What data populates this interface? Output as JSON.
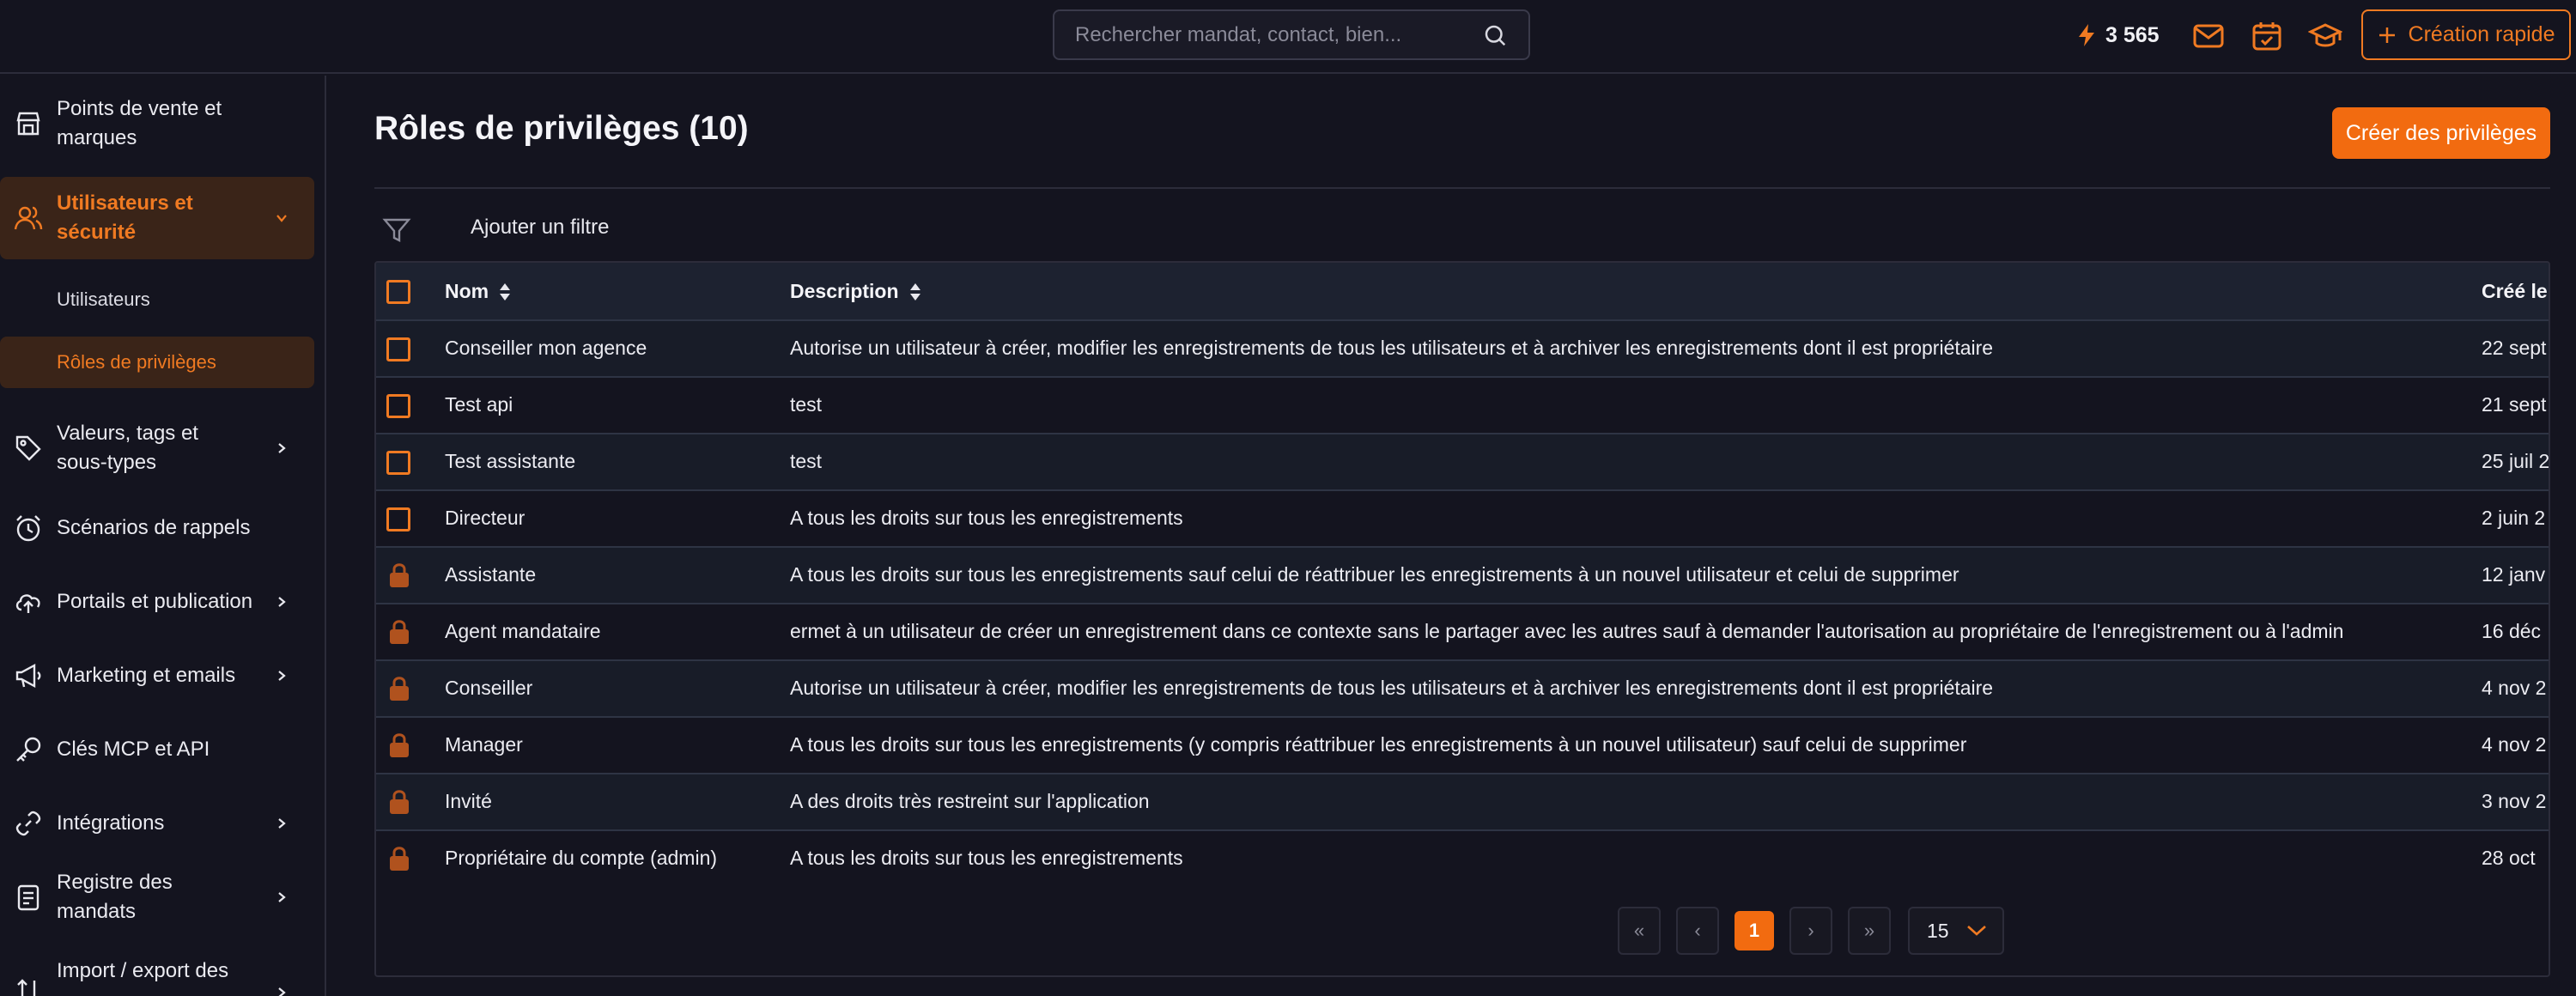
{
  "header": {
    "search_placeholder": "Rechercher mandat, contact, bien...",
    "credits": "3 565",
    "quick_create_label": "Création rapide"
  },
  "icons": {
    "search": "search-icon",
    "bolt": "bolt-icon",
    "mail": "mail-icon",
    "calendar": "calendar-check-icon",
    "academy": "graduation-cap-icon",
    "plus": "plus-icon",
    "filter": "filter-icon",
    "lock": "lock-icon",
    "sort": "sort-icon"
  },
  "colors": {
    "accent": "#f07a22",
    "accent_bg": "#3a2418",
    "background": "#14141f",
    "lock": "#b0521e"
  },
  "sidebar": {
    "items": [
      {
        "label": "Points de vente et marques"
      },
      {
        "label": "Utilisateurs et sécurité"
      },
      {
        "label": "Valeurs, tags et sous-types"
      },
      {
        "label": "Scénarios de rappels"
      },
      {
        "label": "Portails et publication"
      },
      {
        "label": "Marketing et emails"
      },
      {
        "label": "Clés MCP et API"
      },
      {
        "label": "Intégrations"
      },
      {
        "label": "Registre des mandats"
      },
      {
        "label": "Import / export des"
      }
    ],
    "sub_items": [
      {
        "label": "Utilisateurs"
      },
      {
        "label": "Rôles de privilèges"
      }
    ]
  },
  "main": {
    "title": "Rôles de privilèges (10)",
    "create_button": "Créer des privilèges",
    "add_filter": "Ajouter un filtre",
    "columns": {
      "name": "Nom",
      "description": "Description",
      "created": "Créé le"
    },
    "rows": [
      {
        "name": "Conseiller mon agence",
        "description": "Autorise un utilisateur à créer, modifier les enregistrements de tous les utilisateurs et à archiver les enregistrements dont il est propriétaire",
        "date": "22 sept",
        "locked": false
      },
      {
        "name": "Test api",
        "description": "test",
        "date": "21 sept",
        "locked": false
      },
      {
        "name": "Test assistante",
        "description": "test",
        "date": "25 juil 2",
        "locked": false
      },
      {
        "name": "Directeur",
        "description": "A tous les droits sur tous les enregistrements",
        "date": "2 juin 2",
        "locked": false
      },
      {
        "name": "Assistante",
        "description": "A tous les droits sur tous les enregistrements sauf celui de réattribuer les enregistrements à un nouvel utilisateur et celui de supprimer",
        "date": "12 janv",
        "locked": true
      },
      {
        "name": "Agent mandataire",
        "description": "ermet à un utilisateur de créer un enregistrement dans ce contexte sans le partager avec les autres sauf à demander l'autorisation au propriétaire de l'enregistrement ou à l'admin",
        "date": "16 déc",
        "locked": true
      },
      {
        "name": "Conseiller",
        "description": "Autorise un utilisateur à créer, modifier les enregistrements de tous les utilisateurs et à archiver les enregistrements dont il est propriétaire",
        "date": "4 nov 2",
        "locked": true
      },
      {
        "name": "Manager",
        "description": "A tous les droits sur tous les enregistrements (y compris réattribuer les enregistrements à un nouvel utilisateur) sauf celui de supprimer",
        "date": "4 nov 2",
        "locked": true
      },
      {
        "name": "Invité",
        "description": "A des droits très restreint sur l'application",
        "date": "3 nov 2",
        "locked": true
      },
      {
        "name": "Propriétaire du compte (admin)",
        "description": "A tous les droits sur tous les enregistrements",
        "date": "28 oct",
        "locked": true
      }
    ]
  },
  "pagination": {
    "first": "«",
    "prev": "‹",
    "current_page": "1",
    "next": "›",
    "last": "»",
    "per_page": "15"
  }
}
